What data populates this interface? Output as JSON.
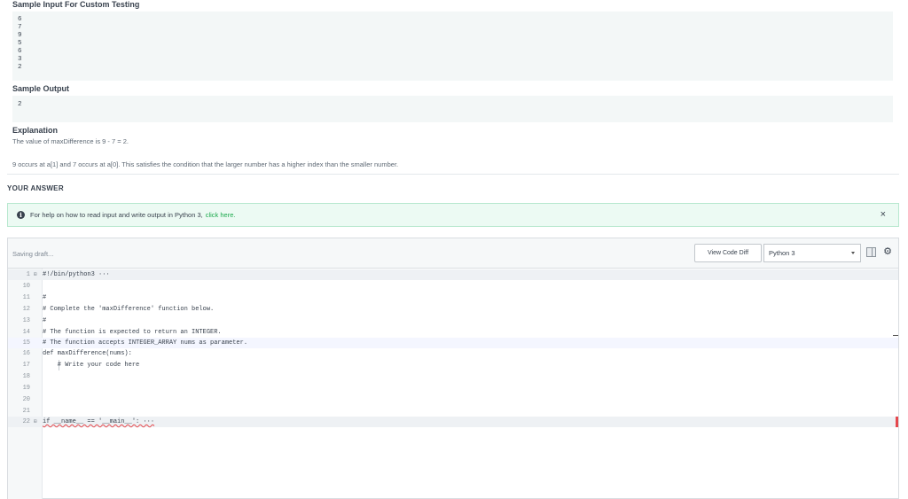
{
  "sample_input": {
    "title": "Sample Input For Custom Testing",
    "lines": [
      "6",
      "7",
      "9",
      "5",
      "6",
      "3",
      "2"
    ]
  },
  "sample_output": {
    "title": "Sample Output",
    "lines": [
      "2"
    ]
  },
  "explanation": {
    "title": "Explanation",
    "line1": "The value of maxDifference is 9 - 7 = 2.",
    "line2": "9 occurs at a[1] and 7 occurs at a[0]. This satisfies the condition that the larger number has a higher index than the smaller number."
  },
  "your_answer_label": "YOUR ANSWER",
  "help_banner": {
    "text": "For help on how to read input and write output in Python 3,",
    "link": "click here.",
    "close": "×"
  },
  "toolbar": {
    "status": "Saving draft...",
    "view_code_diff": "View Code Diff",
    "language": "Python 3"
  },
  "code_lines": [
    {
      "num": "1",
      "fold": "⊞",
      "text": "#!/bin/python3 ···"
    },
    {
      "num": "10",
      "fold": "",
      "text": ""
    },
    {
      "num": "11",
      "fold": "",
      "text": "#"
    },
    {
      "num": "12",
      "fold": "",
      "text": "# Complete the 'maxDifference' function below."
    },
    {
      "num": "13",
      "fold": "",
      "text": "#"
    },
    {
      "num": "14",
      "fold": "",
      "text": "# The function is expected to return an INTEGER."
    },
    {
      "num": "15",
      "fold": "",
      "text": "# The function accepts INTEGER_ARRAY nums as parameter."
    },
    {
      "num": "16",
      "fold": "",
      "text": "def maxDifference(nums):"
    },
    {
      "num": "17",
      "fold": "",
      "text": "    # Write your code here"
    },
    {
      "num": "18",
      "fold": "",
      "text": ""
    },
    {
      "num": "19",
      "fold": "",
      "text": ""
    },
    {
      "num": "20",
      "fold": "",
      "text": ""
    },
    {
      "num": "21",
      "fold": "",
      "text": ""
    },
    {
      "num": "22",
      "fold": "⊞",
      "text": "if __name__ == '__main__': ···"
    }
  ]
}
